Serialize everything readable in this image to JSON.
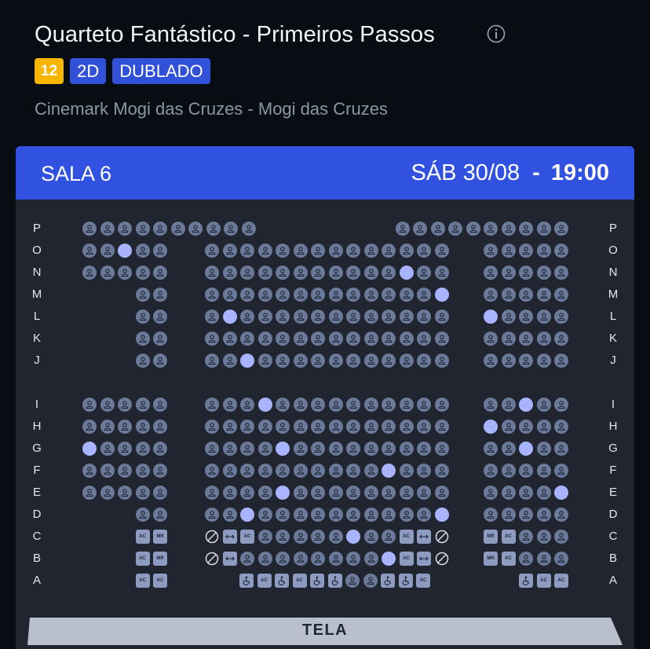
{
  "movie": {
    "title": "Quarteto Fantástico - Primeiros Passos",
    "rating": "12",
    "format": "2D",
    "language": "DUBLADO",
    "cinema": "Cinemark Mogi das Cruzes - Mogi das Cruzes"
  },
  "session": {
    "room": "SALA 6",
    "date": "SÁB 30/08",
    "separator": "-",
    "time": "19:00"
  },
  "screen_label": "TELA",
  "colors": {
    "background": "#070d12",
    "panel": "#212530",
    "header": "#3152e0",
    "seat_available": "#6b7a99",
    "seat_selected": "#a8b4ff",
    "rating_badge": "#f7b500",
    "badge": "#3152d8"
  },
  "legend_codes": {
    "o": "available seat (person icon)",
    "S": "selected/highlighted seat",
    "A": "accompanying seat (AC)",
    "M": "reduced mobility seat (MR)",
    "W": "wheelchair space",
    "X": "unavailable",
    "H": "companion / double seat (arrow)"
  },
  "rows": [
    {
      "label": "P",
      "left": [
        "o",
        "o",
        "o",
        "o",
        "o",
        "o",
        "o",
        "o",
        "o",
        "o"
      ],
      "mid": [],
      "right": [
        "o",
        "o",
        "o",
        "o",
        "o",
        "o",
        "o",
        "o",
        "o",
        "o"
      ]
    },
    {
      "label": "O",
      "left": [
        "o",
        "o",
        "S",
        "o",
        "o"
      ],
      "mid": [
        "o",
        "o",
        "o",
        "o",
        "o",
        "o",
        "o",
        "o",
        "o",
        "o",
        "o",
        "o",
        "o",
        "o"
      ],
      "right": [
        "o",
        "o",
        "o",
        "o",
        "o"
      ]
    },
    {
      "label": "N",
      "left": [
        "o",
        "o",
        "o",
        "o",
        "o"
      ],
      "mid": [
        "o",
        "o",
        "o",
        "o",
        "o",
        "o",
        "o",
        "o",
        "o",
        "o",
        "o",
        "S",
        "o",
        "o"
      ],
      "right": [
        "o",
        "o",
        "o",
        "o",
        "o"
      ]
    },
    {
      "label": "M",
      "left": [
        "o",
        "o"
      ],
      "mid": [
        "o",
        "o",
        "o",
        "o",
        "o",
        "o",
        "o",
        "o",
        "o",
        "o",
        "o",
        "o",
        "o",
        "S"
      ],
      "right": [
        "o",
        "o",
        "o",
        "o",
        "o"
      ]
    },
    {
      "label": "L",
      "left": [
        "o",
        "o"
      ],
      "mid": [
        "o",
        "S",
        "o",
        "o",
        "o",
        "o",
        "o",
        "o",
        "o",
        "o",
        "o",
        "o",
        "o",
        "o"
      ],
      "right": [
        "S",
        "o",
        "o",
        "o",
        "o"
      ]
    },
    {
      "label": "K",
      "left": [
        "o",
        "o"
      ],
      "mid": [
        "o",
        "o",
        "o",
        "o",
        "o",
        "o",
        "o",
        "o",
        "o",
        "o",
        "o",
        "o",
        "o",
        "o"
      ],
      "right": [
        "o",
        "o",
        "o",
        "o",
        "o"
      ]
    },
    {
      "label": "J",
      "left": [
        "o",
        "o"
      ],
      "mid": [
        "o",
        "o",
        "S",
        "o",
        "o",
        "o",
        "o",
        "o",
        "o",
        "o",
        "o",
        "o",
        "o",
        "o"
      ],
      "right": [
        "o",
        "o",
        "o",
        "o",
        "o"
      ]
    },
    {
      "label": "I",
      "left": [
        "o",
        "o",
        "o",
        "o",
        "o"
      ],
      "mid": [
        "o",
        "o",
        "o",
        "S",
        "o",
        "o",
        "o",
        "o",
        "o",
        "o",
        "o",
        "o",
        "o",
        "o"
      ],
      "right": [
        "o",
        "o",
        "S",
        "o",
        "o"
      ]
    },
    {
      "label": "H",
      "left": [
        "o",
        "o",
        "o",
        "o",
        "o"
      ],
      "mid": [
        "o",
        "o",
        "o",
        "o",
        "o",
        "o",
        "o",
        "o",
        "o",
        "o",
        "o",
        "o",
        "o",
        "o"
      ],
      "right": [
        "S",
        "o",
        "o",
        "o",
        "o"
      ]
    },
    {
      "label": "G",
      "left": [
        "S",
        "o",
        "o",
        "o",
        "o"
      ],
      "mid": [
        "o",
        "o",
        "o",
        "o",
        "S",
        "o",
        "o",
        "o",
        "o",
        "o",
        "o",
        "o",
        "o",
        "o"
      ],
      "right": [
        "o",
        "o",
        "S",
        "o",
        "o"
      ]
    },
    {
      "label": "F",
      "left": [
        "o",
        "o",
        "o",
        "o",
        "o"
      ],
      "mid": [
        "o",
        "o",
        "o",
        "o",
        "o",
        "o",
        "o",
        "o",
        "o",
        "o",
        "S",
        "o",
        "o",
        "o"
      ],
      "right": [
        "o",
        "o",
        "o",
        "o",
        "o"
      ]
    },
    {
      "label": "E",
      "left": [
        "o",
        "o",
        "o",
        "o",
        "o"
      ],
      "mid": [
        "o",
        "o",
        "o",
        "o",
        "S",
        "o",
        "o",
        "o",
        "o",
        "o",
        "o",
        "o",
        "o",
        "o"
      ],
      "right": [
        "o",
        "o",
        "o",
        "o",
        "S"
      ]
    },
    {
      "label": "D",
      "left": [
        "o",
        "o"
      ],
      "mid": [
        "o",
        "o",
        "S",
        "o",
        "o",
        "o",
        "o",
        "o",
        "o",
        "o",
        "o",
        "o",
        "o",
        "S"
      ],
      "right": [
        "o",
        "o",
        "o",
        "o",
        "o"
      ]
    },
    {
      "label": "C",
      "left": [
        "A",
        "M"
      ],
      "mid": [
        "X",
        "H",
        "A",
        "o",
        "o",
        "o",
        "o",
        "o",
        "S",
        "o",
        "o",
        "A",
        "H",
        "X"
      ],
      "right": [
        "M",
        "A",
        "o",
        "o",
        "o"
      ]
    },
    {
      "label": "B",
      "left": [
        "A",
        "M"
      ],
      "mid": [
        "X",
        "H",
        "o",
        "o",
        "o",
        "o",
        "o",
        "o",
        "o",
        "o",
        "S",
        "A",
        "H",
        "X"
      ],
      "right": [
        "M",
        "A",
        "o",
        "o",
        "o"
      ]
    },
    {
      "label": "A",
      "left": [
        "A",
        "A"
      ],
      "mid": [
        "W",
        "A",
        "W",
        "A",
        "W",
        "W",
        "o",
        "o",
        "W",
        "W",
        "A"
      ],
      "right": [
        "W",
        "A",
        "A"
      ]
    }
  ]
}
